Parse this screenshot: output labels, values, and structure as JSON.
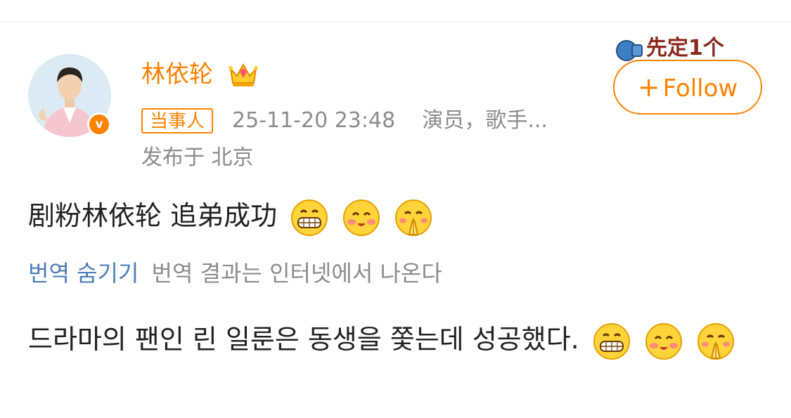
{
  "user": {
    "name": "林依轮",
    "tag": "当事人",
    "timestamp": "25-11-20 23:48",
    "bio": "演员，歌手...",
    "location": "发布于 北京"
  },
  "follow_button": {
    "plus": "+",
    "label": "Follow"
  },
  "sticker": {
    "text": "先定1个"
  },
  "post": {
    "text": "剧粉林依轮 追弟成功",
    "emojis": [
      "grin-icon",
      "blush-icon",
      "pray-icon"
    ]
  },
  "translation": {
    "hide_label": "번역 숨기기",
    "note": "번역 결과는 인터넷에서 나온다",
    "text": "드라마의 팬인 린 일룬은 동생을 쫓는데 성공했다."
  },
  "colors": {
    "accent": "#ff8200",
    "link": "#4b7eb8",
    "muted": "#8c8c8c"
  }
}
